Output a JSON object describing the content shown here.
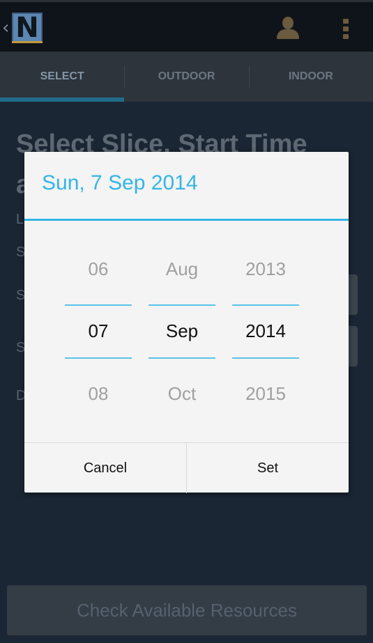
{
  "actionbar": {
    "back_glyph": "‹",
    "logo_letter": "N",
    "icons": [
      "person-icon",
      "overflow-menu-icon"
    ]
  },
  "tabs": [
    {
      "label": "SELECT",
      "active": true
    },
    {
      "label": "OUTDOOR",
      "active": false
    },
    {
      "label": "INDOOR",
      "active": false
    }
  ],
  "content": {
    "heading_line1": "Select Slice, Start Time",
    "heading_line2": "a",
    "row_letters": [
      "L",
      "S",
      "S",
      "S",
      "D"
    ],
    "check_button": "Check Available Resources"
  },
  "dialog": {
    "title": "Sun, 7 Sep 2014",
    "day": {
      "prev": "06",
      "current": "07",
      "next": "08"
    },
    "month": {
      "prev": "Aug",
      "current": "Sep",
      "next": "Oct"
    },
    "year": {
      "prev": "2013",
      "current": "2014",
      "next": "2015"
    },
    "cancel": "Cancel",
    "set": "Set"
  },
  "colors": {
    "accent": "#33b5e5",
    "actionbar": "#0f141a",
    "tab_indicator": "#1f6d89"
  }
}
